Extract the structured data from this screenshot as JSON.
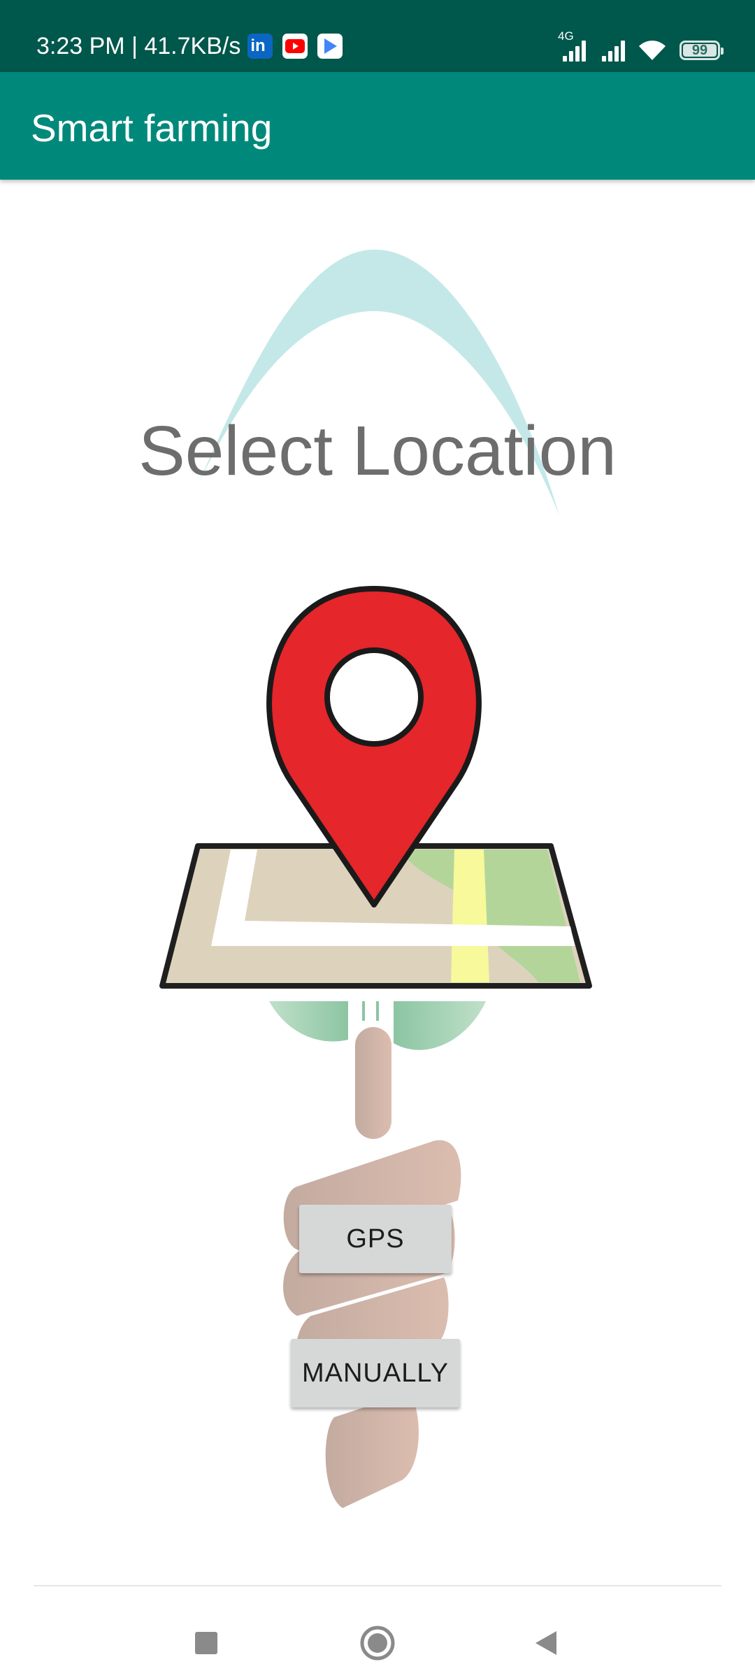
{
  "status_bar": {
    "time_speed": "3:23 PM | 41.7KB/s",
    "network_type": "4G",
    "battery_level": "99",
    "notification_icons": [
      "linkedin-icon",
      "youtube-icon",
      "play-store-icon"
    ],
    "status_icons": [
      "signal-4g-icon",
      "signal-icon",
      "wifi-icon",
      "battery-icon"
    ]
  },
  "app_bar": {
    "title": "Smart farming",
    "color": "#00897b"
  },
  "main": {
    "heading": "Select Location",
    "illustration": "location-pin-on-map-held-by-hand",
    "buttons": {
      "gps": "GPS",
      "manually": "MANUALLY"
    }
  },
  "nav_bar": {
    "icons": [
      "recents-icon",
      "home-icon",
      "back-icon"
    ]
  },
  "colors": {
    "status_bar": "#00574b",
    "app_bar": "#00897b",
    "pin_red": "#e5262a",
    "button_bg": "#d6d7d7",
    "heading_text": "#6d6d6d"
  }
}
